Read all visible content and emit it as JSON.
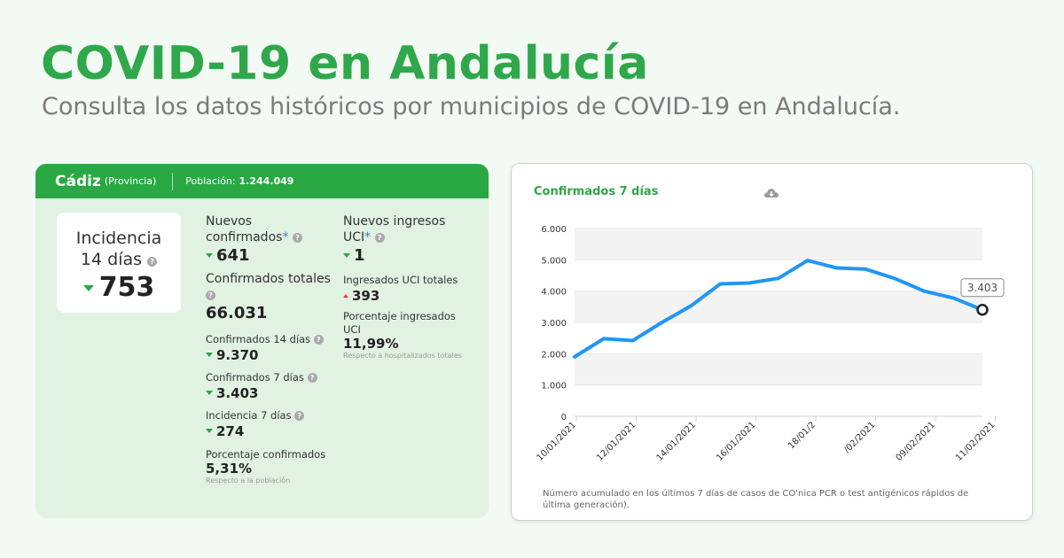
{
  "header": {
    "title": "COVID-19 en Andalucía",
    "subtitle": "Consulta los datos históricos por municipios de COVID-19 en Andalucía."
  },
  "province": {
    "name": "Cádiz",
    "type": "(Provincia)",
    "population_label": "Población:",
    "population_value": "1.244.049"
  },
  "incidence14": {
    "line1": "Incidencia",
    "line2": "14 días",
    "value": "753"
  },
  "stats": {
    "nuevos_confirmados": {
      "label": "Nuevos confirmados",
      "value": "641"
    },
    "confirmados_totales": {
      "label": "Confirmados totales",
      "value": "66.031"
    },
    "confirmados_14": {
      "label": "Confirmados 14 días",
      "value": "9.370"
    },
    "confirmados_7": {
      "label": "Confirmados 7 días",
      "value": "3.403"
    },
    "incidencia_7": {
      "label": "Incidencia 7 días",
      "value": "274"
    },
    "porcentaje_confirmados": {
      "label": "Porcentaje confirmados",
      "value": "5,31%",
      "note": "Respecto a la población"
    },
    "nuevos_uci": {
      "label": "Nuevos ingresos UCI",
      "value": "1"
    },
    "ingresados_uci_totales": {
      "label": "Ingresados UCI totales",
      "value": "393"
    },
    "porcentaje_uci": {
      "label": "Porcentaje ingresados UCI",
      "value": "11,99%",
      "note": "Respecto a hospitalizados totales"
    }
  },
  "chart_panel": {
    "title": "Confirmados 7 días",
    "note": "Número acumulado en los últimos 7 días de casos de CO'nica PCR o test antigénicos rápidos de última generación).",
    "tooltip": "3.403"
  },
  "colors": {
    "brand_green": "#2aa844",
    "line_blue": "#2196f3",
    "down_arrow": "#2aa844",
    "up_arrow": "#e0403a"
  },
  "chart_data": {
    "type": "line",
    "x": [
      "10/01/2021",
      "11/01/2021",
      "12/01/2021",
      "13/01/2021",
      "14/01/2021",
      "15/01/2021",
      "16/01/2021",
      "17/01/2021",
      "18/01/2021",
      "19/01/2021",
      "08/02/2021",
      "09/02/2021",
      "10/02/2021",
      "11/02/2021",
      "12/02/2021"
    ],
    "values": [
      1900,
      2480,
      2420,
      3000,
      3530,
      4230,
      4260,
      4410,
      4980,
      4740,
      4700,
      4400,
      4000,
      3780,
      3403
    ],
    "tick_labels": [
      "10/01/2021",
      "12/01/2021",
      "14/01/2021",
      "16/01/2021",
      "18/01/2",
      "/02/2021",
      "09/02/2021",
      "11/02/2021"
    ],
    "y_ticks": [
      "0",
      "1.000",
      "2.000",
      "3.000",
      "4.000",
      "5.000",
      "6.000"
    ],
    "ylim": [
      0,
      6000
    ],
    "grid": "banded",
    "highlight_last": "3.403"
  }
}
